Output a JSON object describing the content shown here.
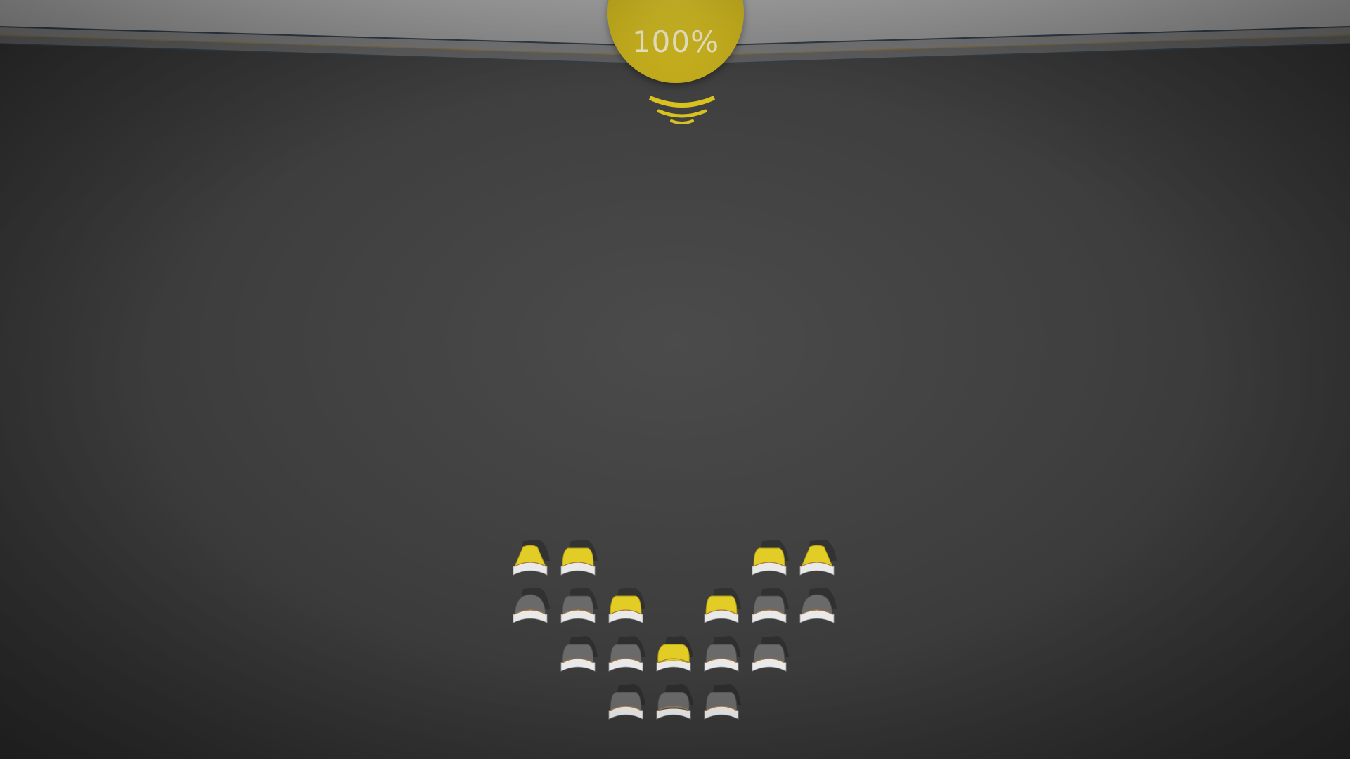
{
  "hud": {
    "progress_label": "100%",
    "progress_value": 1.0
  },
  "colors": {
    "lit": "#e2cd27",
    "unlit": "#6a6a6a",
    "base": "#e9e9e9",
    "background": "#424242"
  },
  "board": {
    "rows": [
      {
        "row": 0,
        "tiles": [
          {
            "col": 0,
            "shape": "peak",
            "state": "lit"
          },
          {
            "col": 1,
            "shape": "arch",
            "state": "lit"
          },
          {
            "col": 5,
            "shape": "arch",
            "state": "lit"
          },
          {
            "col": 6,
            "shape": "peak",
            "state": "lit"
          }
        ]
      },
      {
        "row": 1,
        "tiles": [
          {
            "col": 0,
            "shape": "dome",
            "state": "unlit"
          },
          {
            "col": 1,
            "shape": "arch",
            "state": "unlit"
          },
          {
            "col": 2,
            "shape": "arch",
            "state": "lit"
          },
          {
            "col": 4,
            "shape": "arch",
            "state": "lit"
          },
          {
            "col": 5,
            "shape": "arch",
            "state": "unlit"
          },
          {
            "col": 6,
            "shape": "dome",
            "state": "unlit"
          }
        ]
      },
      {
        "row": 2,
        "tiles": [
          {
            "col": 1,
            "shape": "arch",
            "state": "unlit"
          },
          {
            "col": 2,
            "shape": "arch",
            "state": "unlit"
          },
          {
            "col": 3,
            "shape": "round",
            "state": "lit"
          },
          {
            "col": 4,
            "shape": "arch",
            "state": "unlit"
          },
          {
            "col": 5,
            "shape": "arch",
            "state": "unlit"
          }
        ]
      },
      {
        "row": 3,
        "tiles": [
          {
            "col": 2,
            "shape": "arch",
            "state": "unlit"
          },
          {
            "col": 3,
            "shape": "round",
            "state": "unlit"
          },
          {
            "col": 4,
            "shape": "arch",
            "state": "unlit"
          }
        ]
      }
    ]
  }
}
